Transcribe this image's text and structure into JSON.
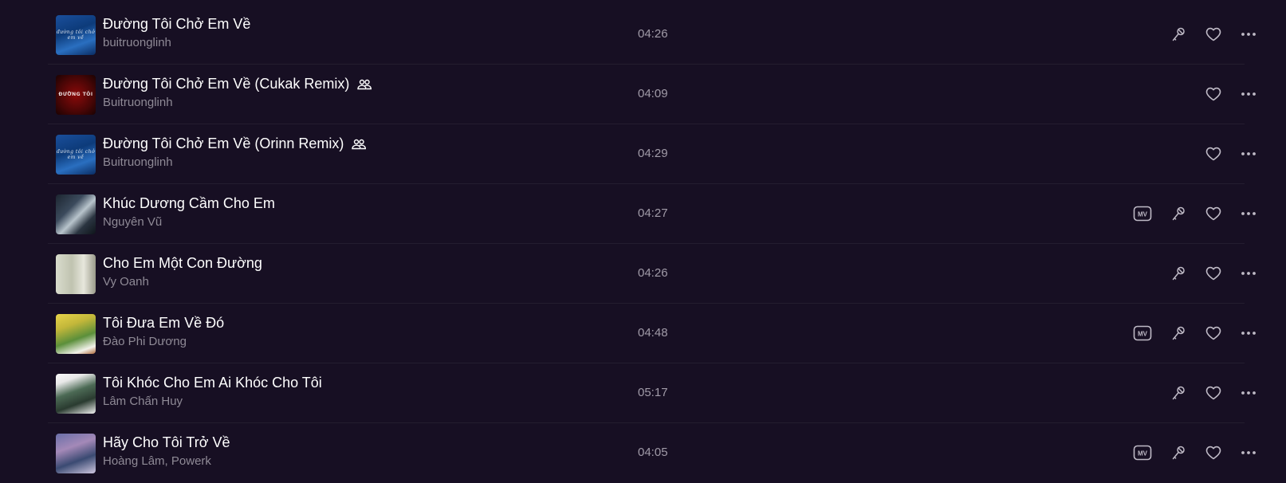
{
  "colors": {
    "background": "#170f23",
    "title": "#ffffff",
    "artist": "#8f8a96",
    "duration": "#a19ba8",
    "icon": "#bfbac6"
  },
  "songs": [
    {
      "title": "Đường Tôi Chở Em Về",
      "artist": "buitruonglinh",
      "duration": "04:26",
      "collab": false,
      "mv": false,
      "lyric": true,
      "thumb_style": "t-blue",
      "thumb_text": "đường tôi chở em về"
    },
    {
      "title": "Đường Tôi Chở Em Về (Cukak Remix)",
      "artist": "Buitruonglinh",
      "duration": "04:09",
      "collab": true,
      "mv": false,
      "lyric": false,
      "thumb_style": "t-red",
      "thumb_text": "ĐƯỜNG TÔI"
    },
    {
      "title": "Đường Tôi Chở Em Về (Orinn Remix)",
      "artist": "Buitruonglinh",
      "duration": "04:29",
      "collab": true,
      "mv": false,
      "lyric": false,
      "thumb_style": "t-blue",
      "thumb_text": "đường tôi chở em về"
    },
    {
      "title": "Khúc Dương Cầm Cho Em",
      "artist": "Nguyên Vũ",
      "duration": "04:27",
      "collab": false,
      "mv": true,
      "lyric": true,
      "thumb_style": "t-dark",
      "thumb_text": ""
    },
    {
      "title": "Cho Em Một Con Đường",
      "artist": "Vy Oanh",
      "duration": "04:26",
      "collab": false,
      "mv": false,
      "lyric": true,
      "thumb_style": "t-pale",
      "thumb_text": ""
    },
    {
      "title": "Tôi Đưa Em Về Đó",
      "artist": "Đào Phi Dương",
      "duration": "04:48",
      "collab": false,
      "mv": true,
      "lyric": true,
      "thumb_style": "t-yellow",
      "thumb_text": ""
    },
    {
      "title": "Tôi Khóc Cho Em Ai Khóc Cho Tôi",
      "artist": "Lâm Chấn Huy",
      "duration": "05:17",
      "collab": false,
      "mv": false,
      "lyric": true,
      "thumb_style": "t-frame",
      "thumb_text": ""
    },
    {
      "title": "Hãy Cho Tôi Trở Về",
      "artist": "Hoàng Lâm, Powerk",
      "duration": "04:05",
      "collab": false,
      "mv": true,
      "lyric": true,
      "thumb_style": "t-purple",
      "thumb_text": ""
    }
  ]
}
